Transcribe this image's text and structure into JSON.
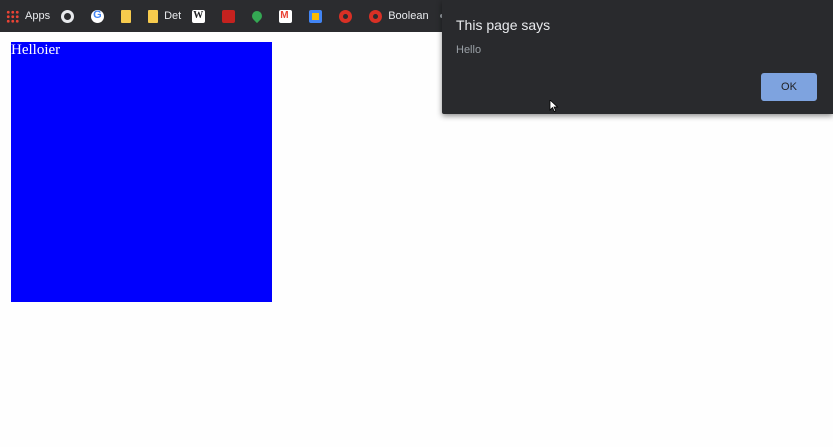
{
  "bookmarks_bar": {
    "items": [
      {
        "icon": "apps-grid-icon",
        "label": "Apps"
      },
      {
        "icon": "globe-icon",
        "label": ""
      },
      {
        "icon": "google-icon",
        "label": ""
      },
      {
        "icon": "folder-icon",
        "label": ""
      },
      {
        "icon": "folder-icon",
        "label": "Det"
      },
      {
        "icon": "wikipedia-icon",
        "label": ""
      },
      {
        "icon": "pdf-icon",
        "label": ""
      },
      {
        "icon": "maps-pin-icon",
        "label": ""
      },
      {
        "icon": "gmail-icon",
        "label": ""
      },
      {
        "icon": "docs-icon",
        "label": ""
      },
      {
        "icon": "gear-icon",
        "label": ""
      },
      {
        "icon": "gear-icon",
        "label": "Boolean"
      }
    ]
  },
  "page": {
    "box_text": "Helloier",
    "box_color": "#0000fe"
  },
  "alert_dialog": {
    "title": "This page says",
    "message": "Hello",
    "ok_label": "OK",
    "ok_color": "#8ab4f8"
  }
}
